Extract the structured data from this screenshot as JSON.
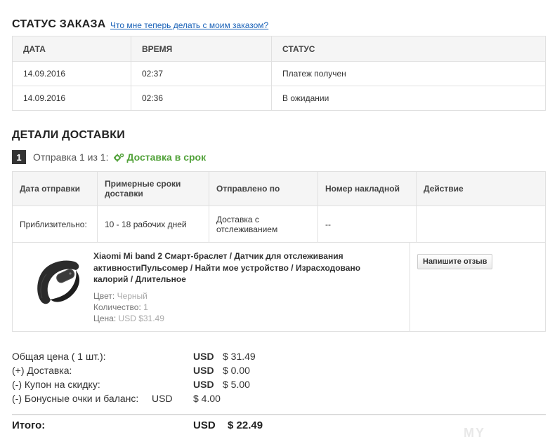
{
  "order_status": {
    "title": "СТАТУС ЗАКАЗА",
    "help_link": "Что мне теперь делать с моим заказом?",
    "columns": [
      "ДАТА",
      "ВРЕМЯ",
      "СТАТУС"
    ],
    "rows": [
      {
        "date": "14.09.2016",
        "time": "02:37",
        "status": "Платеж получен"
      },
      {
        "date": "14.09.2016",
        "time": "02:36",
        "status": "В ожидании"
      }
    ]
  },
  "delivery": {
    "title": "ДЕТАЛИ ДОСТАВКИ",
    "shipment_number": "1",
    "shipment_label": "Отправка 1 из 1:",
    "shipment_status": "Доставка в срок",
    "columns": [
      "Дата отправки",
      "Примерные сроки доставки",
      "Отправлено по",
      "Номер накладной",
      "Действие"
    ],
    "row": {
      "ship_date": "Приблизительно:",
      "estimate": "10 - 18 рабочих дней",
      "method": "Доставка с отслеживанием",
      "tracking": "--",
      "action": ""
    }
  },
  "product": {
    "title": "Xiaomi Mi band 2 Смарт-браслет / Датчик для отслеживания активностиПульсомер / Найти мое устройство / Израсходовано калорий / Длительное",
    "color_label": "Цвет:",
    "color_value": "Черный",
    "qty_label": "Количество:",
    "qty_value": "1",
    "price_label": "Цена:",
    "price_value": "USD $31.49",
    "review_button": "Напишите отзыв"
  },
  "summary": {
    "items": [
      {
        "label": "Общая цена ( 1 шт.):",
        "currency": "USD",
        "value": "$ 31.49"
      },
      {
        "label": "(+) Доставка:",
        "currency": "USD",
        "value": "$ 0.00"
      },
      {
        "label": "(-) Купон на скидку:",
        "currency": "USD",
        "value": "$ 5.00"
      }
    ],
    "bonus": {
      "label": "(-) Бонусные очки и баланс:",
      "currency": "USD",
      "value": "$ 4.00"
    },
    "total": {
      "label": "Итого:",
      "currency": "USD",
      "value": "$ 22.49"
    }
  },
  "watermark": "MY",
  "colors": {
    "accent_green": "#52a23a",
    "link_blue": "#1a62b8"
  }
}
